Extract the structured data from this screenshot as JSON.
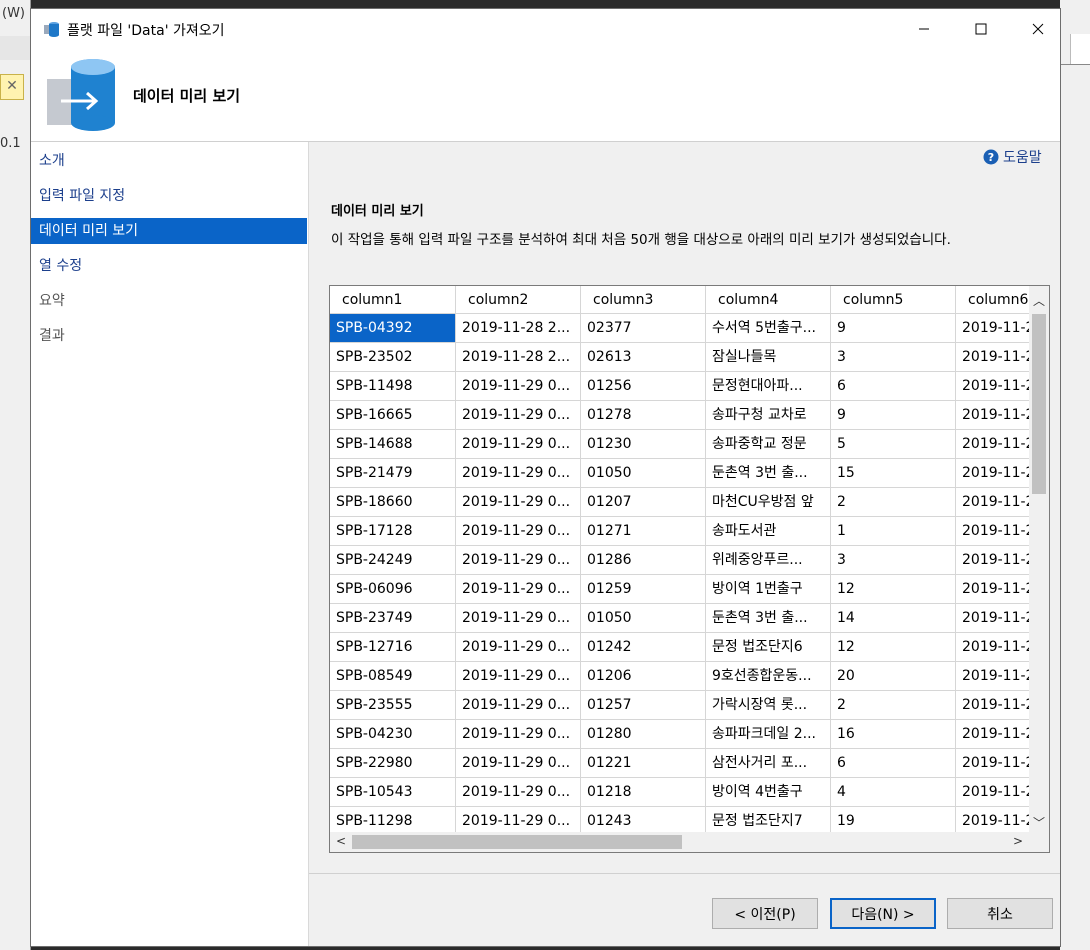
{
  "background": {
    "left_menu_fragment": "(W)",
    "left_value_fragment": "0.1"
  },
  "titlebar": {
    "title": "플랫 파일 'Data' 가져오기",
    "minimize_icon": "minimize-icon",
    "maximize_icon": "maximize-icon",
    "close_icon": "close-icon"
  },
  "header": {
    "title": "데이터 미리 보기"
  },
  "sidebar": {
    "items": [
      {
        "label": "소개"
      },
      {
        "label": "입력 파일 지정"
      },
      {
        "label": "데이터 미리 보기"
      },
      {
        "label": "열 수정"
      },
      {
        "label": "요약"
      },
      {
        "label": "결과"
      }
    ]
  },
  "help": {
    "label": "도움말",
    "icon": "help-icon"
  },
  "main": {
    "section_title": "데이터 미리 보기",
    "description": "이 작업을 통해 입력 파일 구조를 분석하여 최대 처음 50개 행을 대상으로 아래의 미리 보기가 생성되었습니다."
  },
  "grid": {
    "columns": [
      "column1",
      "column2",
      "column3",
      "column4",
      "column5",
      "column6"
    ],
    "rows": [
      [
        "SPB-04392",
        "2019-11-28 2...",
        "02377",
        "수서역 5번출구...",
        "9",
        "2019-11-2"
      ],
      [
        "SPB-23502",
        "2019-11-28 2...",
        "02613",
        "잠실나들목",
        "3",
        "2019-11-2"
      ],
      [
        "SPB-11498",
        "2019-11-29 0...",
        "01256",
        "문정현대아파...",
        "6",
        "2019-11-2"
      ],
      [
        "SPB-16665",
        "2019-11-29 0...",
        "01278",
        "송파구청 교차로",
        "9",
        "2019-11-2"
      ],
      [
        "SPB-14688",
        "2019-11-29 0...",
        "01230",
        "송파중학교 정문",
        "5",
        "2019-11-2"
      ],
      [
        "SPB-21479",
        "2019-11-29 0...",
        "01050",
        "둔촌역 3번 출...",
        "15",
        "2019-11-2"
      ],
      [
        "SPB-18660",
        "2019-11-29 0...",
        "01207",
        "마천CU우방점 앞",
        "2",
        "2019-11-2"
      ],
      [
        "SPB-17128",
        "2019-11-29 0...",
        "01271",
        "송파도서관",
        "1",
        "2019-11-2"
      ],
      [
        "SPB-24249",
        "2019-11-29 0...",
        "01286",
        "위례중앙푸르...",
        "3",
        "2019-11-2"
      ],
      [
        "SPB-06096",
        "2019-11-29 0...",
        "01259",
        "방이역 1번출구",
        "12",
        "2019-11-2"
      ],
      [
        "SPB-23749",
        "2019-11-29 0...",
        "01050",
        "둔촌역 3번 출...",
        "14",
        "2019-11-2"
      ],
      [
        "SPB-12716",
        "2019-11-29 0...",
        "01242",
        "문정 법조단지6",
        "12",
        "2019-11-2"
      ],
      [
        "SPB-08549",
        "2019-11-29 0...",
        "01206",
        "9호선종합운동...",
        "20",
        "2019-11-2"
      ],
      [
        "SPB-23555",
        "2019-11-29 0...",
        "01257",
        "가락시장역 롯...",
        "2",
        "2019-11-2"
      ],
      [
        "SPB-04230",
        "2019-11-29 0...",
        "01280",
        "송파파크데일 2...",
        "16",
        "2019-11-2"
      ],
      [
        "SPB-22980",
        "2019-11-29 0...",
        "01221",
        "삼전사거리 포...",
        "6",
        "2019-11-2"
      ],
      [
        "SPB-10543",
        "2019-11-29 0...",
        "01218",
        "방이역 4번출구",
        "4",
        "2019-11-2"
      ],
      [
        "SPB-11298",
        "2019-11-29 0...",
        "01243",
        "문정 법조단지7",
        "19",
        "2019-11-2"
      ]
    ]
  },
  "buttons": {
    "prev": "< 이전(P)",
    "next": "다음(N) >",
    "cancel": "취소"
  }
}
